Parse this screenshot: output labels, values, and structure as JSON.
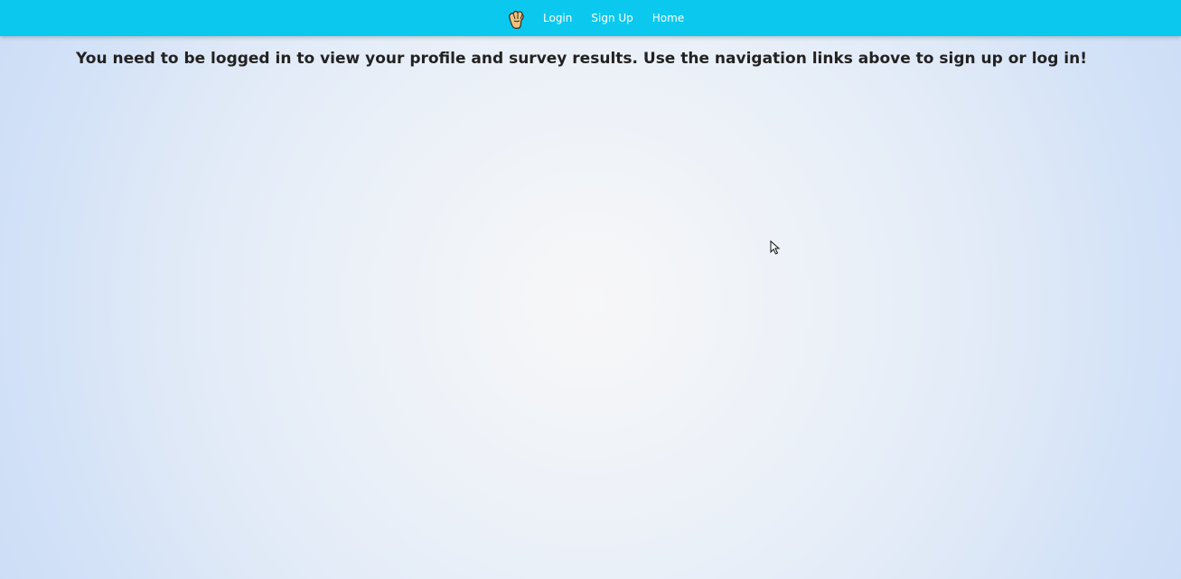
{
  "nav": {
    "logo_icon": "hand-icon",
    "links": [
      {
        "label": "Login"
      },
      {
        "label": "Sign Up"
      },
      {
        "label": "Home"
      }
    ]
  },
  "main": {
    "message": "You need to be logged in to view your profile and survey results. Use the navigation links above to sign up or log in!"
  },
  "colors": {
    "navbar": "#0bc8ef",
    "text": "#222222",
    "background_center": "#f7f7f8",
    "background_edge": "#cadcf6"
  },
  "cursor_icon": "mouse-pointer-icon"
}
